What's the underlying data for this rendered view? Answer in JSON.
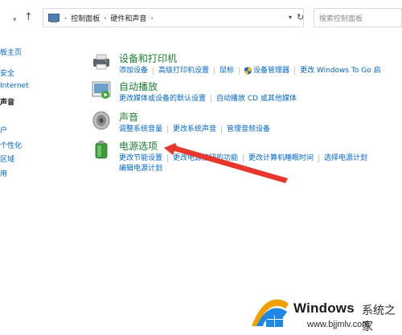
{
  "address_bar": {
    "back_icon": "chevron-down-icon",
    "up_icon": "up-arrow-icon",
    "crumbs": [
      "控制面板",
      "硬件和声音"
    ],
    "search_placeholder": "搜索控制面板"
  },
  "left_pane": {
    "items": [
      {
        "label": "板主页"
      },
      {
        "label": "安全"
      },
      {
        "label": "Internet"
      },
      {
        "label": "声音",
        "active": true
      },
      {
        "label": "户"
      },
      {
        "label": "个性化"
      },
      {
        "label": "区域"
      },
      {
        "label": "用"
      }
    ]
  },
  "categories": [
    {
      "title": "设备和打印机",
      "icon": "printer-icon",
      "links": [
        [
          "添加设备",
          "高级打印机设置",
          "鼠标",
          "设备管理器",
          "更改 Windows To Go 启"
        ]
      ]
    },
    {
      "title": "自动播放",
      "icon": "autoplay-icon",
      "links": [
        [
          "更改媒体或设备的默认设置",
          "自动播放 CD 或其他媒体"
        ]
      ]
    },
    {
      "title": "声音",
      "icon": "speaker-icon",
      "links": [
        [
          "调整系统音量",
          "更改系统声音",
          "管理音频设备"
        ]
      ]
    },
    {
      "title": "电源选项",
      "icon": "battery-icon",
      "links": [
        [
          "更改节能设置",
          "更改电源按钮的功能",
          "更改计算机睡眠时间",
          "选择电源计划"
        ],
        [
          "编辑电源计划"
        ]
      ]
    }
  ],
  "watermark": {
    "brand": "Windows",
    "sub": "系统之家",
    "url": "www.bjjmlv.com"
  },
  "colors": {
    "link": "#0066cc",
    "title": "#1e7d32",
    "arrow": "#e8372c"
  }
}
